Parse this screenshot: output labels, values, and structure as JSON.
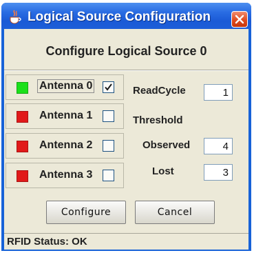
{
  "window": {
    "title": "Logical Source Configuration"
  },
  "heading": "Configure Logical Source 0",
  "antennas": [
    {
      "label": "Antenna 0",
      "status_color": "#1be01b",
      "checked": true
    },
    {
      "label": "Antenna 1",
      "status_color": "#e11a1a",
      "checked": false
    },
    {
      "label": "Antenna 2",
      "status_color": "#e11a1a",
      "checked": false
    },
    {
      "label": "Antenna 3",
      "status_color": "#e11a1a",
      "checked": false
    }
  ],
  "settings": {
    "readcycle_label": "ReadCycle",
    "readcycle_value": "1",
    "threshold_label": "Threshold",
    "observed_label": "Observed",
    "observed_value": "4",
    "lost_label": "Lost",
    "lost_value": "3"
  },
  "buttons": {
    "configure": "Configure",
    "cancel": "Cancel"
  },
  "status_bar": {
    "text": "RFID Status: OK"
  },
  "icons": {
    "app": "java-cup-icon",
    "close": "close-icon",
    "check": "check-icon"
  }
}
